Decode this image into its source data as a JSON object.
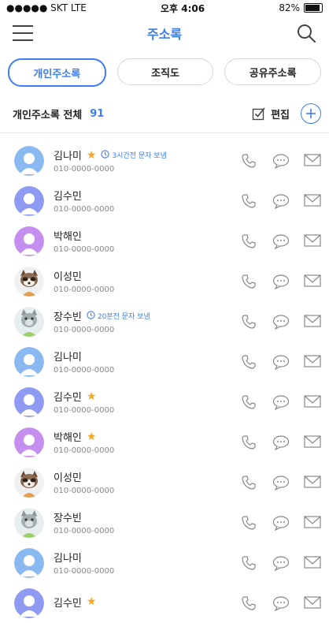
{
  "statusbar": {
    "carrier": "●●●●● SKT  LTE",
    "time": "오후 4:06",
    "battery": "82%"
  },
  "header": {
    "title": "주소록"
  },
  "tabs": [
    {
      "label": "개인주소록",
      "active": true
    },
    {
      "label": "조직도",
      "active": false
    },
    {
      "label": "공유주소록",
      "active": false
    }
  ],
  "summary": {
    "label": "개인주소록 전체",
    "count": "91",
    "edit_label": "편집"
  },
  "contacts": [
    {
      "name": "김나미",
      "phone": "010-0000-0000",
      "avatar": "blue",
      "star": true,
      "note": "3시간전 문자 보냄"
    },
    {
      "name": "김수민",
      "phone": "010-0000-0000",
      "avatar": "indigo",
      "star": false,
      "note": ""
    },
    {
      "name": "박해인",
      "phone": "010-0000-0000",
      "avatar": "purple",
      "star": false,
      "note": ""
    },
    {
      "name": "이성민",
      "phone": "010-0000-0000",
      "avatar": "raccoon",
      "star": false,
      "note": ""
    },
    {
      "name": "장수빈",
      "phone": "010-0000-0000",
      "avatar": "cat",
      "star": false,
      "note": "20분전 문자 보냄"
    },
    {
      "name": "김나미",
      "phone": "010-0000-0000",
      "avatar": "blue",
      "star": false,
      "note": ""
    },
    {
      "name": "김수민",
      "phone": "010-0000-0000",
      "avatar": "indigo",
      "star": true,
      "note": ""
    },
    {
      "name": "박해인",
      "phone": "010-0000-0000",
      "avatar": "purple",
      "star": true,
      "note": ""
    },
    {
      "name": "이성민",
      "phone": "010-0000-0000",
      "avatar": "raccoon",
      "star": false,
      "note": ""
    },
    {
      "name": "장수빈",
      "phone": "010-0000-0000",
      "avatar": "cat",
      "star": false,
      "note": ""
    },
    {
      "name": "김나미",
      "phone": "010-0000-0000",
      "avatar": "blue",
      "star": false,
      "note": ""
    },
    {
      "name": "김수민",
      "phone": "",
      "avatar": "indigo",
      "star": true,
      "note": ""
    }
  ],
  "colors": {
    "accent": "#3d7df2",
    "star": "#f5a623",
    "avatar_blue": "#8ab8f0",
    "avatar_indigo": "#8f9bf2",
    "avatar_purple": "#c58ff0"
  },
  "icons": {
    "menu": "hamburger-icon",
    "search": "search-icon",
    "edit": "checkbox-edit-icon",
    "add": "plus-circle-icon",
    "call": "phone-icon",
    "chat": "chat-bubble-icon",
    "mail": "envelope-icon",
    "clock": "clock-icon",
    "star": "star-icon"
  }
}
